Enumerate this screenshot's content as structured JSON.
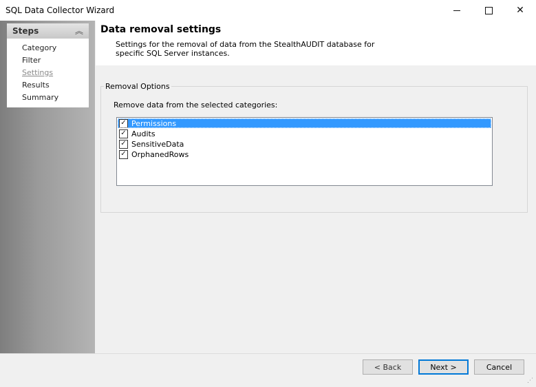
{
  "window": {
    "title": "SQL Data Collector Wizard"
  },
  "sidebar": {
    "header": "Steps",
    "items": [
      {
        "label": "Category",
        "active": false
      },
      {
        "label": "Filter",
        "active": false
      },
      {
        "label": "Settings",
        "active": true
      },
      {
        "label": "Results",
        "active": false
      },
      {
        "label": "Summary",
        "active": false
      }
    ]
  },
  "page": {
    "title": "Data removal settings",
    "description": "Settings for the removal of data from the StealthAUDIT database for specific SQL Server instances."
  },
  "options": {
    "group_label": "Removal Options",
    "prompt": "Remove data from the selected categories:",
    "categories": [
      {
        "label": "Permissions",
        "checked": true,
        "selected": true
      },
      {
        "label": "Audits",
        "checked": true,
        "selected": false
      },
      {
        "label": "SensitiveData",
        "checked": true,
        "selected": false
      },
      {
        "label": "OrphanedRows",
        "checked": true,
        "selected": false
      }
    ]
  },
  "buttons": {
    "back": "< Back",
    "next": "Next >",
    "cancel": "Cancel"
  },
  "colors": {
    "selection": "#3399ff",
    "default_button_border": "#0078d7"
  }
}
